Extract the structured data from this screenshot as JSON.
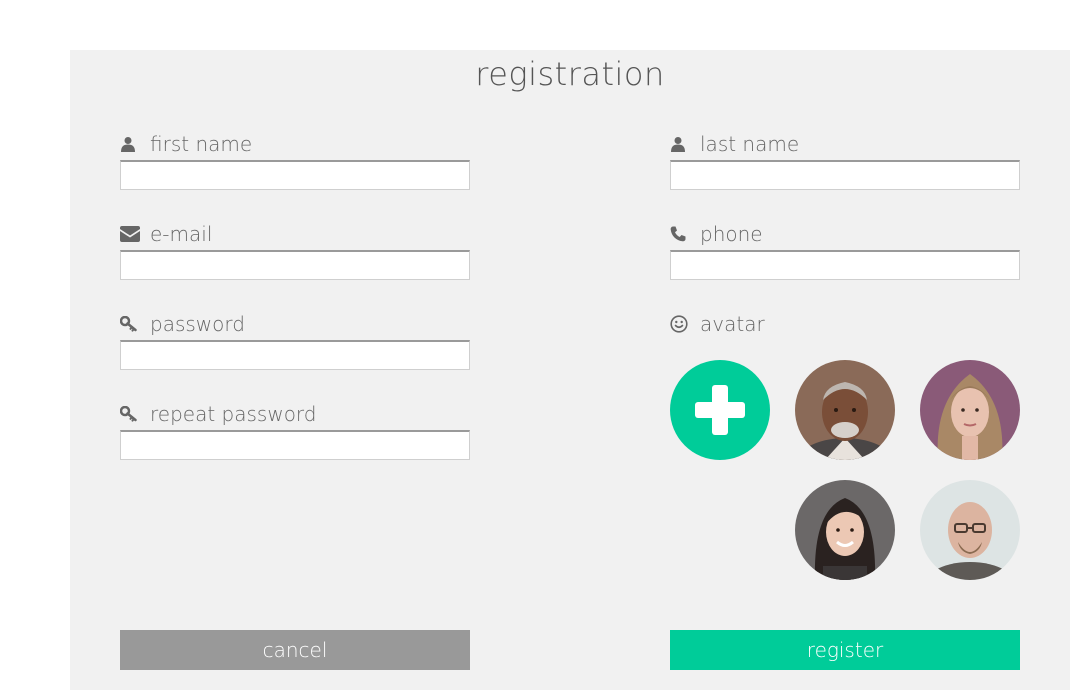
{
  "title": "registration",
  "colors": {
    "accent": "#00cc99",
    "cancel": "#999999",
    "panel": "#f1f1f1"
  },
  "fields": {
    "first_name": {
      "label": "first name",
      "icon": "user-icon",
      "value": ""
    },
    "last_name": {
      "label": "last name",
      "icon": "user-icon",
      "value": ""
    },
    "email": {
      "label": "e-mail",
      "icon": "envelope-icon",
      "value": ""
    },
    "phone": {
      "label": "phone",
      "icon": "phone-icon",
      "value": ""
    },
    "password": {
      "label": "password",
      "icon": "key-icon",
      "value": ""
    },
    "repeat_password": {
      "label": "repeat password",
      "icon": "key-icon",
      "value": ""
    }
  },
  "avatar": {
    "label": "avatar",
    "icon": "smiley-icon",
    "options": [
      {
        "name": "add-avatar",
        "icon": "plus-icon"
      },
      {
        "name": "avatar-option-older-man"
      },
      {
        "name": "avatar-option-young-woman"
      },
      {
        "name": "avatar-option-smiling-woman"
      },
      {
        "name": "avatar-option-bald-man-glasses"
      }
    ]
  },
  "buttons": {
    "cancel": "cancel",
    "register": "register"
  }
}
